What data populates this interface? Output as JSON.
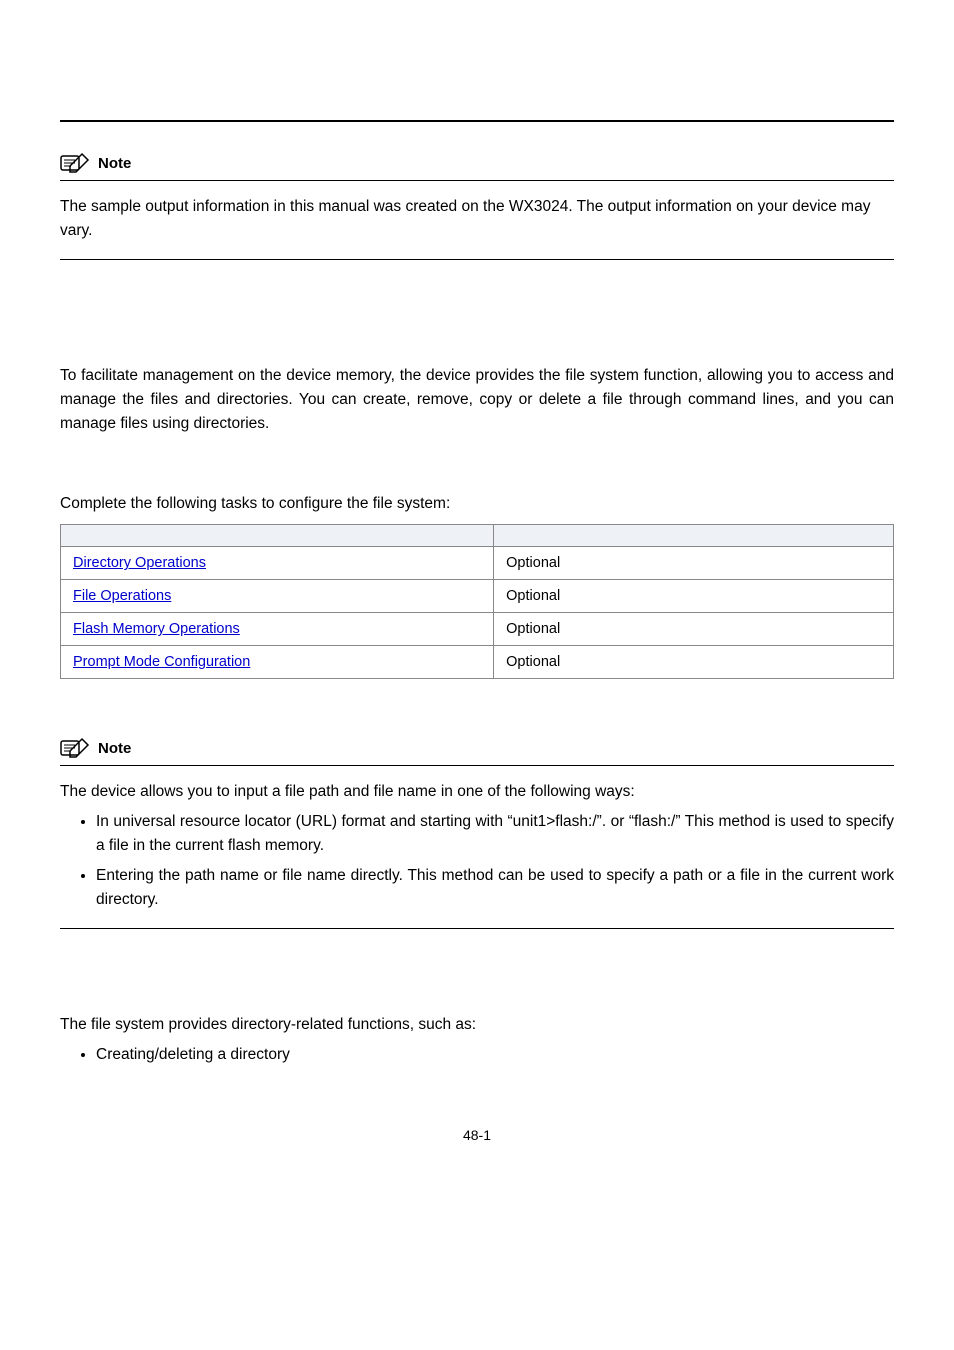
{
  "note1": {
    "label": "Note",
    "text": "The sample output information in this manual was created on the WX3024. The output information on your device may vary."
  },
  "intro": "To facilitate management on the device memory, the device provides the file system function, allowing you to access and manage the files and directories. You can create, remove, copy or delete a file through command lines, and you can manage files using directories.",
  "tasks_intro": "Complete the following tasks to configure the file system:",
  "tasks": {
    "headers": [
      "",
      ""
    ],
    "rows": [
      {
        "task": "Directory Operations",
        "remarks": "Optional"
      },
      {
        "task": "File Operations",
        "remarks": "Optional"
      },
      {
        "task": "Flash Memory Operations",
        "remarks": "Optional"
      },
      {
        "task": "Prompt Mode Configuration",
        "remarks": "Optional"
      }
    ]
  },
  "note2": {
    "label": "Note",
    "lead": "The device allows you to input a file path and file name in one of the following ways:",
    "items": [
      "In universal resource locator (URL) format and starting with “unit1>flash:/”. or “flash:/” This method is used to specify a file in the current flash memory.",
      "Entering the path name or file name directly. This method can be used to specify a path or a file in the current work directory."
    ]
  },
  "dir_intro": "The file system provides directory-related functions, such as:",
  "dir_items": [
    "Creating/deleting a directory"
  ],
  "page_number": "48-1"
}
